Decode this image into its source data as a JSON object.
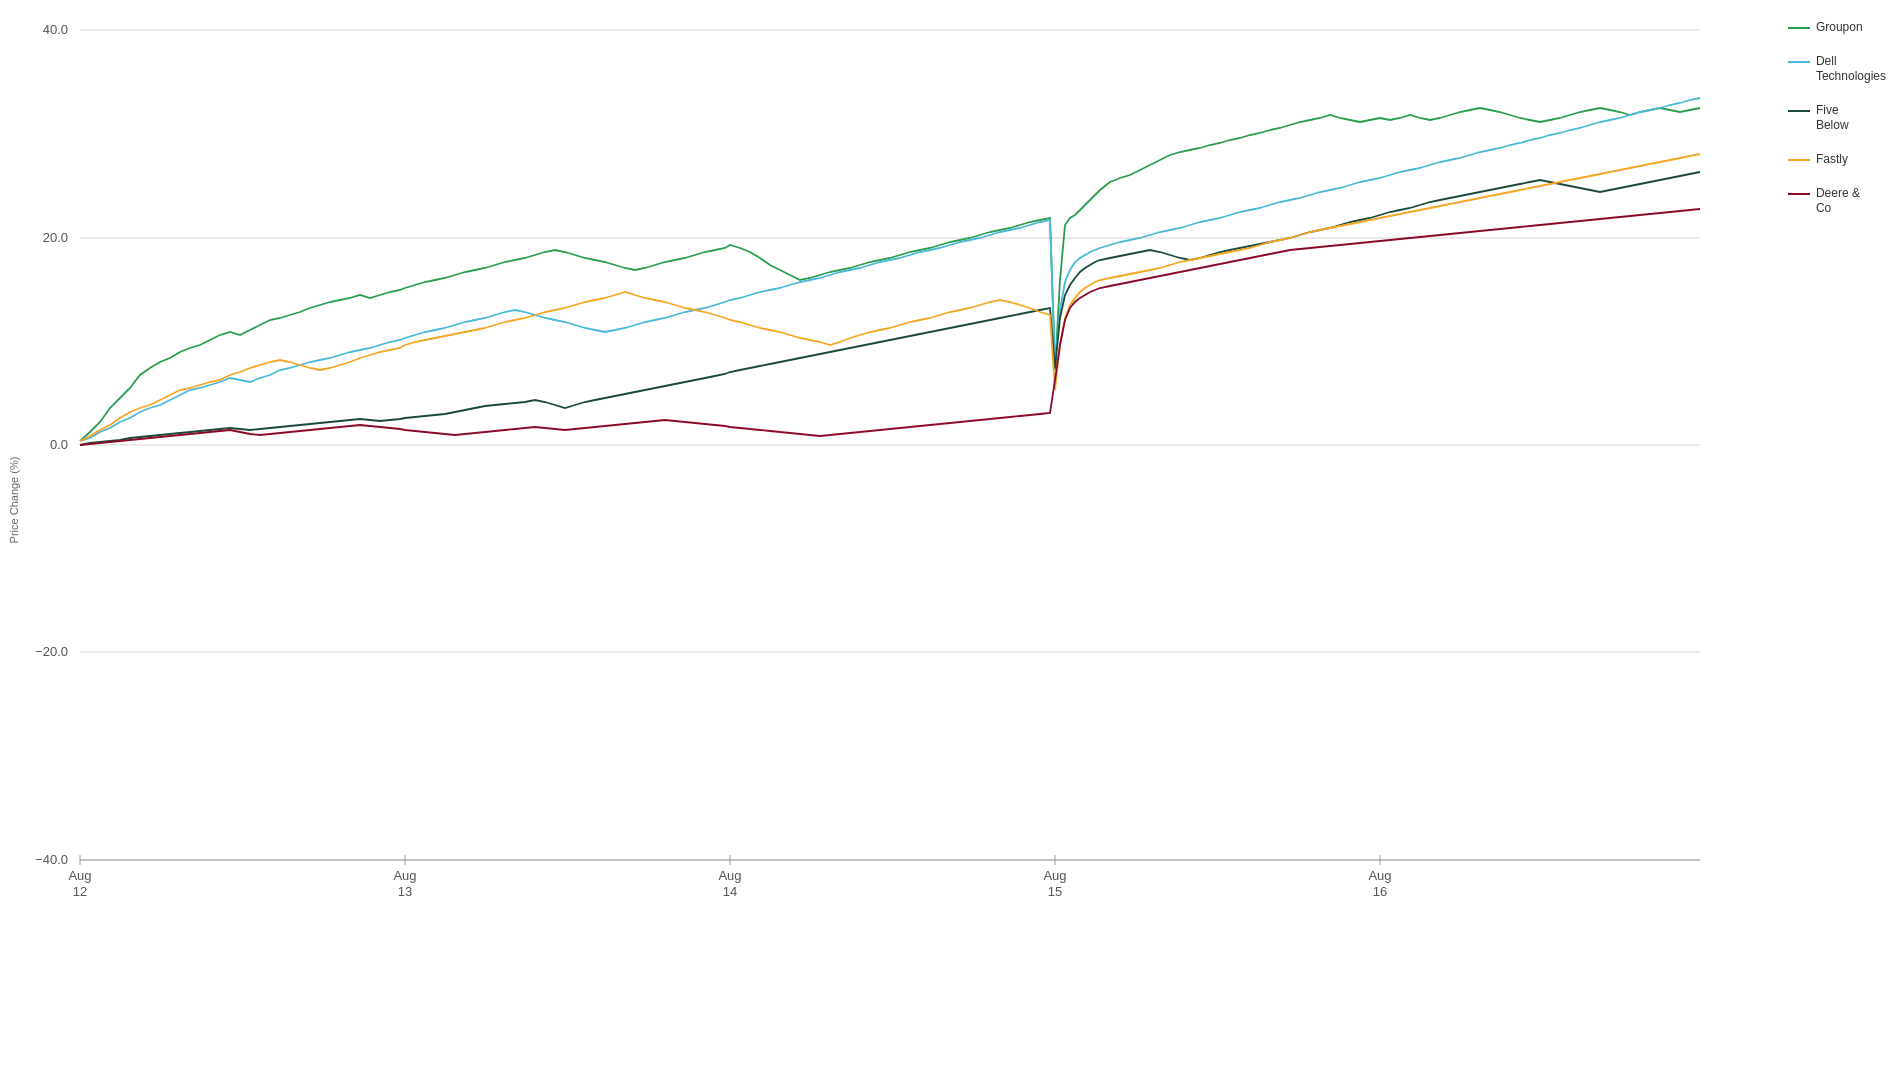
{
  "chart": {
    "title": "Price Change (%)",
    "y_axis": {
      "labels": [
        "40.0",
        "20.0",
        "0.0",
        "-20.0",
        "-40.0"
      ]
    },
    "x_axis": {
      "labels": [
        {
          "date": "Aug",
          "day": "12"
        },
        {
          "date": "Aug",
          "day": "13"
        },
        {
          "date": "Aug",
          "day": "14"
        },
        {
          "date": "Aug",
          "day": "15"
        },
        {
          "date": "Aug",
          "day": "16"
        }
      ]
    },
    "legend": [
      {
        "name": "Groupon",
        "color": "#2a9d4e"
      },
      {
        "name": "Dell\nTechnologies",
        "color": "#4ab8d8"
      },
      {
        "name": "Five\nBelow",
        "color": "#1a4a3a"
      },
      {
        "name": "Fastly",
        "color": "#f5a623"
      },
      {
        "name": "Deere &\nCo",
        "color": "#8b0a2a"
      }
    ]
  }
}
